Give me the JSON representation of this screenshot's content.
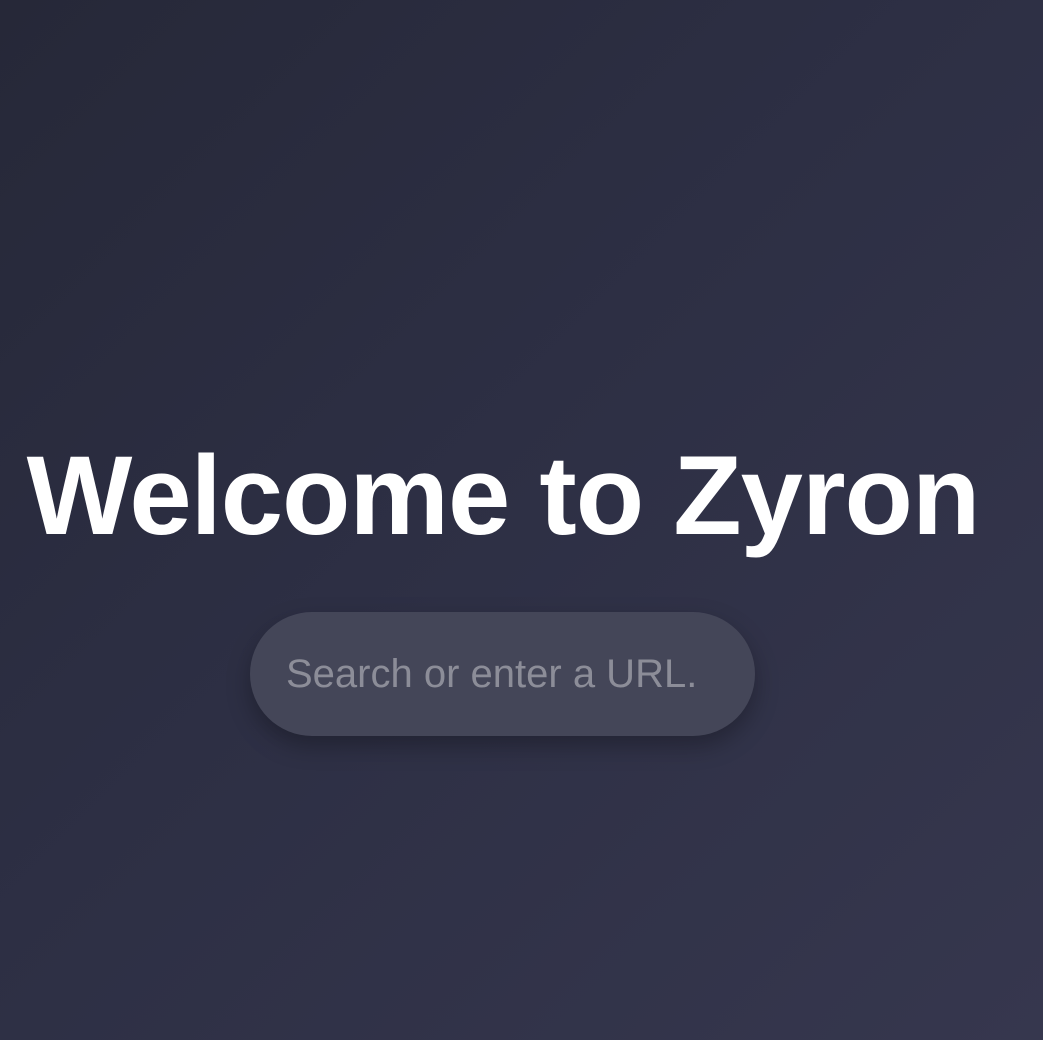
{
  "page": {
    "title": "Welcome to Zyron"
  },
  "search": {
    "placeholder": "Search or enter a URL.",
    "value": ""
  },
  "colors": {
    "background_start": "#262838",
    "background_end": "#36374e",
    "title_text": "#ffffff",
    "search_background": "#444658",
    "placeholder_text": "#8c8d98"
  }
}
